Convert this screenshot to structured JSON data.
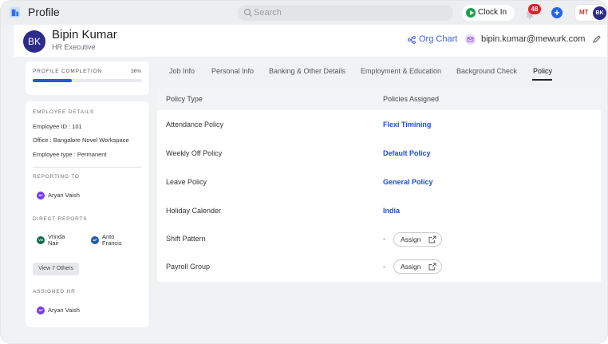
{
  "header": {
    "title": "Profile",
    "search_placeholder": "Search",
    "clock_in_label": "Clock In",
    "notification_count": "48",
    "plus_label": "+",
    "user_initials_left": "MT",
    "user_initials_right": "BK"
  },
  "profile": {
    "initials": "BK",
    "name": "Bipin Kumar",
    "role": "HR Executive",
    "org_chart_label": "Org Chart",
    "email": "bipin.kumar@mewurk.com"
  },
  "completion": {
    "label": "PROFILE COMPLETION",
    "percent_text": "36%",
    "percent": 36
  },
  "employee_details": {
    "title": "EMPLOYEE DETAILS",
    "employee_id": "Employee ID : 101",
    "office": "Office : Bangalore Novel Workspace",
    "employee_type": "Employee type : Permanent",
    "reporting_to_title": "REPORTING TO",
    "reporting_to": {
      "initials": "AV",
      "name": "Aryan Vaish"
    },
    "direct_reports_title": "DIRECT REPORTS",
    "direct_reports": [
      {
        "initials": "VN",
        "line1": "Vrinda",
        "line2": "Nair"
      },
      {
        "initials": "AF",
        "line1": "Anto",
        "line2": "Francis"
      }
    ],
    "view_others_label": "View 7 Others",
    "assigned_hr_title": "ASSIGNED HR",
    "assigned_hr": {
      "initials": "AV",
      "name": "Aryan Vaish"
    }
  },
  "tabs": [
    {
      "label": "Job Info"
    },
    {
      "label": "Personal Info"
    },
    {
      "label": "Banking & Other Details"
    },
    {
      "label": "Employment & Education"
    },
    {
      "label": "Background Check"
    },
    {
      "label": "Policy"
    }
  ],
  "active_tab": "Policy",
  "policy_table": {
    "columns": [
      "Policy Type",
      "Policies Assigned"
    ],
    "rows": [
      {
        "type": "Attendance Policy",
        "assigned": "Flexi Timining"
      },
      {
        "type": "Weekly Off Policy",
        "assigned": "Default Policy"
      },
      {
        "type": "Leave Policy",
        "assigned": "General Policy"
      },
      {
        "type": "Holiday Calender",
        "assigned": "India"
      },
      {
        "type": "Shift Pattern",
        "assigned": "-",
        "action": "Assign"
      },
      {
        "type": "Payroll Group",
        "assigned": "-",
        "action": "Assign"
      }
    ]
  },
  "colors": {
    "accent": "#2557d6",
    "link": "#1d4ed8",
    "avatar": "#2e2a8a",
    "clock_in": "#17a34a",
    "badge": "#e11d2e"
  }
}
